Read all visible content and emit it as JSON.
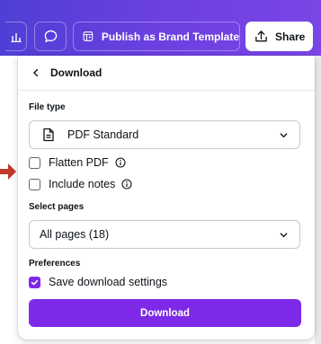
{
  "toolbar": {
    "chart_icon": "bar-chart-icon",
    "comment_icon": "comment-icon",
    "publish_icon": "template-icon",
    "publish_label": "Publish as Brand Template",
    "share_icon": "upload-icon",
    "share_label": "Share"
  },
  "panel": {
    "title": "Download",
    "file_type": {
      "label": "File type",
      "value": "PDF Standard",
      "icon": "document-icon"
    },
    "options": [
      {
        "label": "Flatten PDF",
        "checked": false,
        "info": true
      },
      {
        "label": "Include notes",
        "checked": false,
        "info": true
      }
    ],
    "select_pages": {
      "label": "Select pages",
      "value": "All pages (18)"
    },
    "preferences": {
      "label": "Preferences",
      "save_settings": {
        "label": "Save download settings",
        "checked": true
      }
    },
    "download_label": "Download"
  },
  "colors": {
    "accent": "#7d2ae8",
    "toolbar_start": "#4f3fd6",
    "toolbar_end": "#7a46e6",
    "arrow": "#c0392b"
  }
}
